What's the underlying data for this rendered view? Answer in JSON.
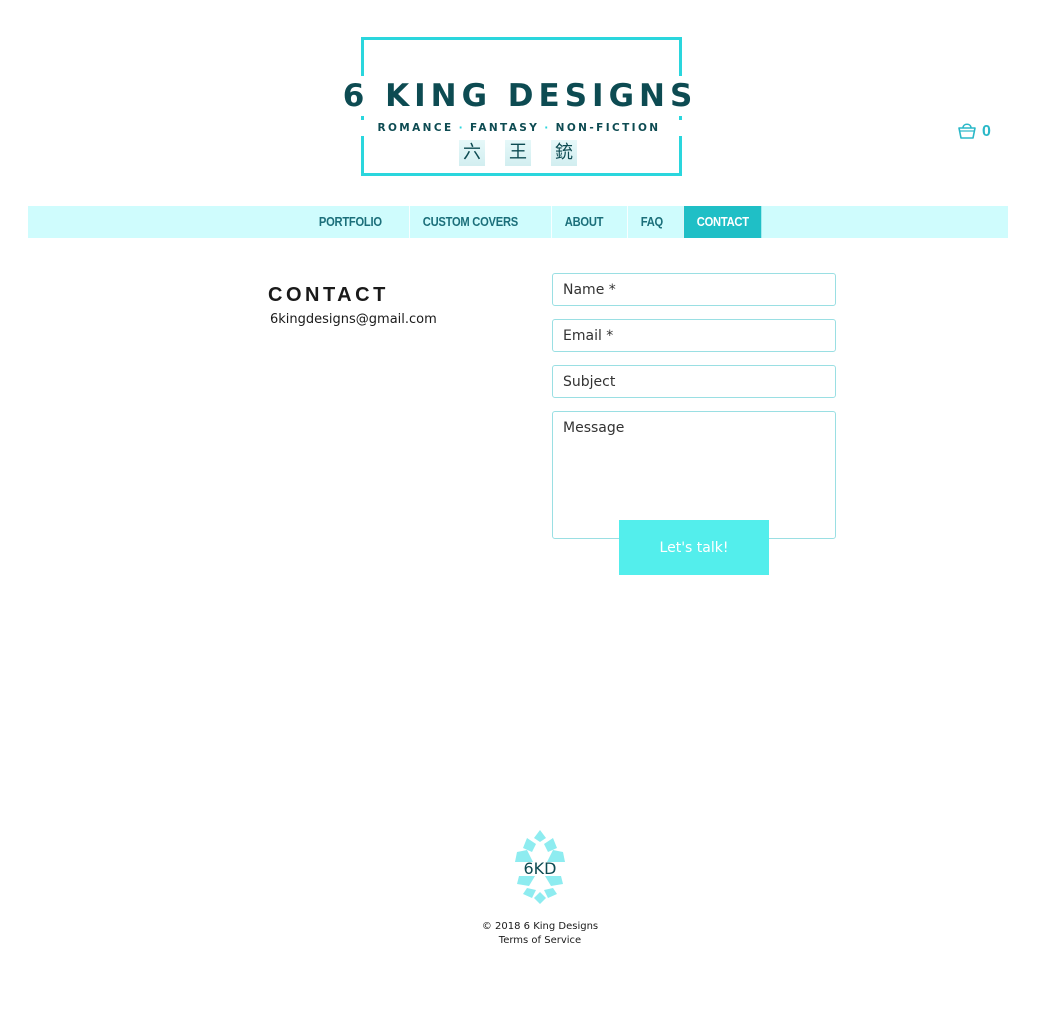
{
  "logo": {
    "title": "6 KING DESIGNS",
    "genres": [
      "ROMANCE",
      "FANTASY",
      "NON-FICTION"
    ],
    "separator": "·",
    "chars": [
      "六",
      "王",
      "銃"
    ],
    "frame_color": "#2ad6dd",
    "text_color": "#0d4b52"
  },
  "cart": {
    "icon": "shopping-bag-icon",
    "count": "0"
  },
  "nav": {
    "items": [
      {
        "label": "PORTFOLIO"
      },
      {
        "label": "CUSTOM COVERS"
      },
      {
        "label": "ABOUT"
      },
      {
        "label": "FAQ"
      },
      {
        "label": "CONTACT",
        "active": true
      }
    ],
    "bar_color": "#cffcfd",
    "active_color": "#1fbfc6"
  },
  "contact": {
    "heading": "CONTACT",
    "email": "6kingdesigns@gmail.com"
  },
  "form": {
    "name_placeholder": "Name *",
    "email_placeholder": "Email *",
    "subject_placeholder": "Subject",
    "message_placeholder": "Message",
    "submit_label": "Let's talk!",
    "submit_color": "#53eeec"
  },
  "footer": {
    "logo_text": "6KD",
    "copyright": "© 2018 6 King Designs",
    "terms": "Terms of Service"
  }
}
